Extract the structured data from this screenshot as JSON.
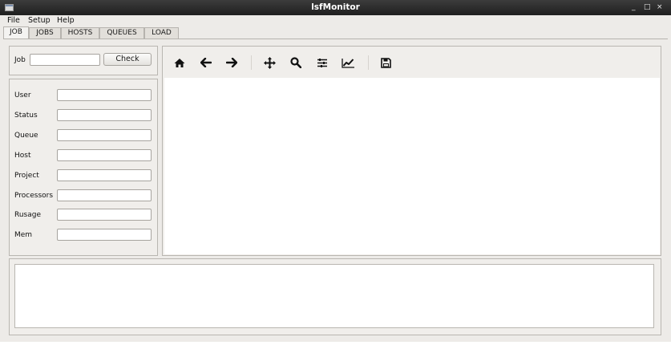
{
  "window": {
    "title": "lsfMonitor",
    "controls": [
      "_",
      "□",
      "×"
    ]
  },
  "menu": [
    "File",
    "Setup",
    "Help"
  ],
  "tabs": [
    "JOB",
    "JOBS",
    "HOSTS",
    "QUEUES",
    "LOAD"
  ],
  "active_tab": "JOB",
  "job_search": {
    "label": "Job",
    "value": "",
    "button": "Check"
  },
  "job_info": {
    "fields": [
      {
        "label": "User",
        "value": ""
      },
      {
        "label": "Status",
        "value": ""
      },
      {
        "label": "Queue",
        "value": ""
      },
      {
        "label": "Host",
        "value": ""
      },
      {
        "label": "Project",
        "value": ""
      },
      {
        "label": "Processors",
        "value": ""
      },
      {
        "label": "Rusage",
        "value": ""
      },
      {
        "label": "Mem",
        "value": ""
      }
    ]
  },
  "toolbar": {
    "icons": [
      "home-icon",
      "back-arrow-icon",
      "forward-arrow-icon",
      "move-icon",
      "zoom-icon",
      "configure-subplots-icon",
      "edit-axis-icon",
      "save-icon"
    ]
  },
  "output_text": "",
  "colors": {
    "titlebar": "#2b2b2b",
    "window_bg": "#edebe8",
    "icon": "#111111"
  }
}
